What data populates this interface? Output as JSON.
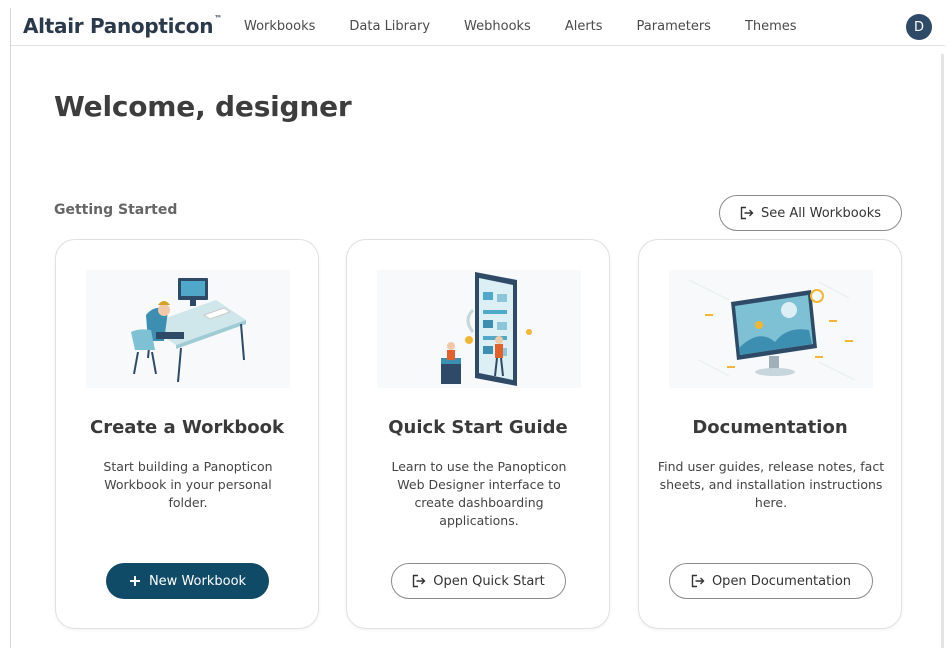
{
  "app": {
    "brand": "Altair Panopticon",
    "brand_mark": "™",
    "avatar_initial": "D"
  },
  "nav": {
    "items": [
      "Workbooks",
      "Data Library",
      "Webhooks",
      "Alerts",
      "Parameters",
      "Themes"
    ]
  },
  "header": {
    "welcome": "Welcome, designer"
  },
  "getting_started": {
    "title": "Getting Started",
    "see_all_label": "See All Workbooks"
  },
  "cards": [
    {
      "title": "Create a Workbook",
      "description": "Start building a Panopticon Workbook in your personal folder.",
      "button": "New Workbook",
      "button_icon": "plus-icon",
      "illustration": "desk-workstation-illustration"
    },
    {
      "title": "Quick Start Guide",
      "description": "Learn to use the Panopticon Web Designer interface to create dashboarding applications.",
      "button": "Open Quick Start",
      "button_icon": "open-external-icon",
      "illustration": "mobile-app-builder-illustration"
    },
    {
      "title": "Documentation",
      "description": "Find user guides, release notes, fact sheets, and installation instructions here.",
      "button": "Open Documentation",
      "button_icon": "open-external-icon",
      "illustration": "monitor-dashboard-illustration"
    }
  ],
  "colors": {
    "primary": "#0f4a66",
    "brand_text": "#2b3a4a",
    "avatar_bg": "#2e4a66"
  }
}
